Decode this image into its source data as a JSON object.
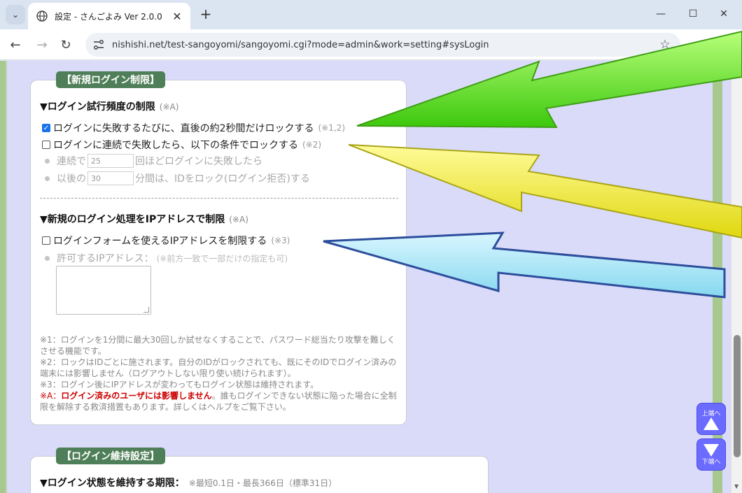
{
  "browser": {
    "tab_title": "設定 - さんごよみ Ver 2.0.0",
    "new_tab_label": "+",
    "url": "nishishi.net/test-sangoyomi/sangoyomi.cgi?mode=admin&work=setting#sysLogin"
  },
  "section1": {
    "badge": "【新規ログイン制限】",
    "group1": {
      "heading": "▼ログイン試行頻度の制限",
      "heading_note": "(※A)",
      "option1_label": "ログインに失敗するたびに、直後の約2秒間だけロックする",
      "option1_note": "(※1,2)",
      "option1_checked": true,
      "option2_label": "ログインに連続で失敗したら、以下の条件でロックする",
      "option2_note": "(※2)",
      "option2_checked": false,
      "consecutive_prefix": "連続で",
      "consecutive_value": "25",
      "consecutive_suffix": "回ほどログインに失敗したら",
      "after_prefix": "以後の",
      "after_value": "30",
      "after_suffix": "分間は、IDをロック(ログイン拒否)する"
    },
    "group2": {
      "heading": "▼新規のログイン処理をIPアドレスで制限",
      "heading_note": "(※A)",
      "option_label": "ログインフォームを使えるIPアドレスを制限する",
      "option_note": "(※3)",
      "option_checked": false,
      "allowed_ip_label": "許可するIPアドレス：",
      "allowed_ip_note": "(※前方一致で一部だけの指定も可)"
    },
    "footnotes": {
      "n1": "※1：ログインを1分間に最大30回しか試せなくすることで、パスワード総当たり攻撃を難しくさせる機能です。",
      "n2": "※2：ロックはIDごとに施されます。自分のIDがロックされても、既にそのIDでログイン済みの端末には影響しません（ログアウトしない限り使い続けられます）。",
      "n3": "※3：ログイン後にIPアドレスが変わってもログイン状態は維持されます。",
      "nA_label": "※A：",
      "nA_red": "ログイン済みのユーザには影響しません",
      "nA_rest": "。誰もログインできない状態に陥った場合に全制限を解除する救済措置もあります。詳しくはヘルプをご覧下さい。"
    }
  },
  "section2": {
    "badge": "【ログイン維持設定】",
    "heading": "▼ログイン状態を維持する期限：",
    "heading_note": "※最短0.1日・最長366日（標準31日）"
  },
  "jump": {
    "top_label": "上端へ",
    "bottom_label": "下端へ"
  },
  "colors": {
    "page_background": "#dadbf9",
    "badge_green": "#4f7f58",
    "jump_button": "#6b6bff",
    "arrow_green": "#55d412",
    "arrow_yellow": "#e8e21a",
    "arrow_blue": "#9fe4f5"
  }
}
